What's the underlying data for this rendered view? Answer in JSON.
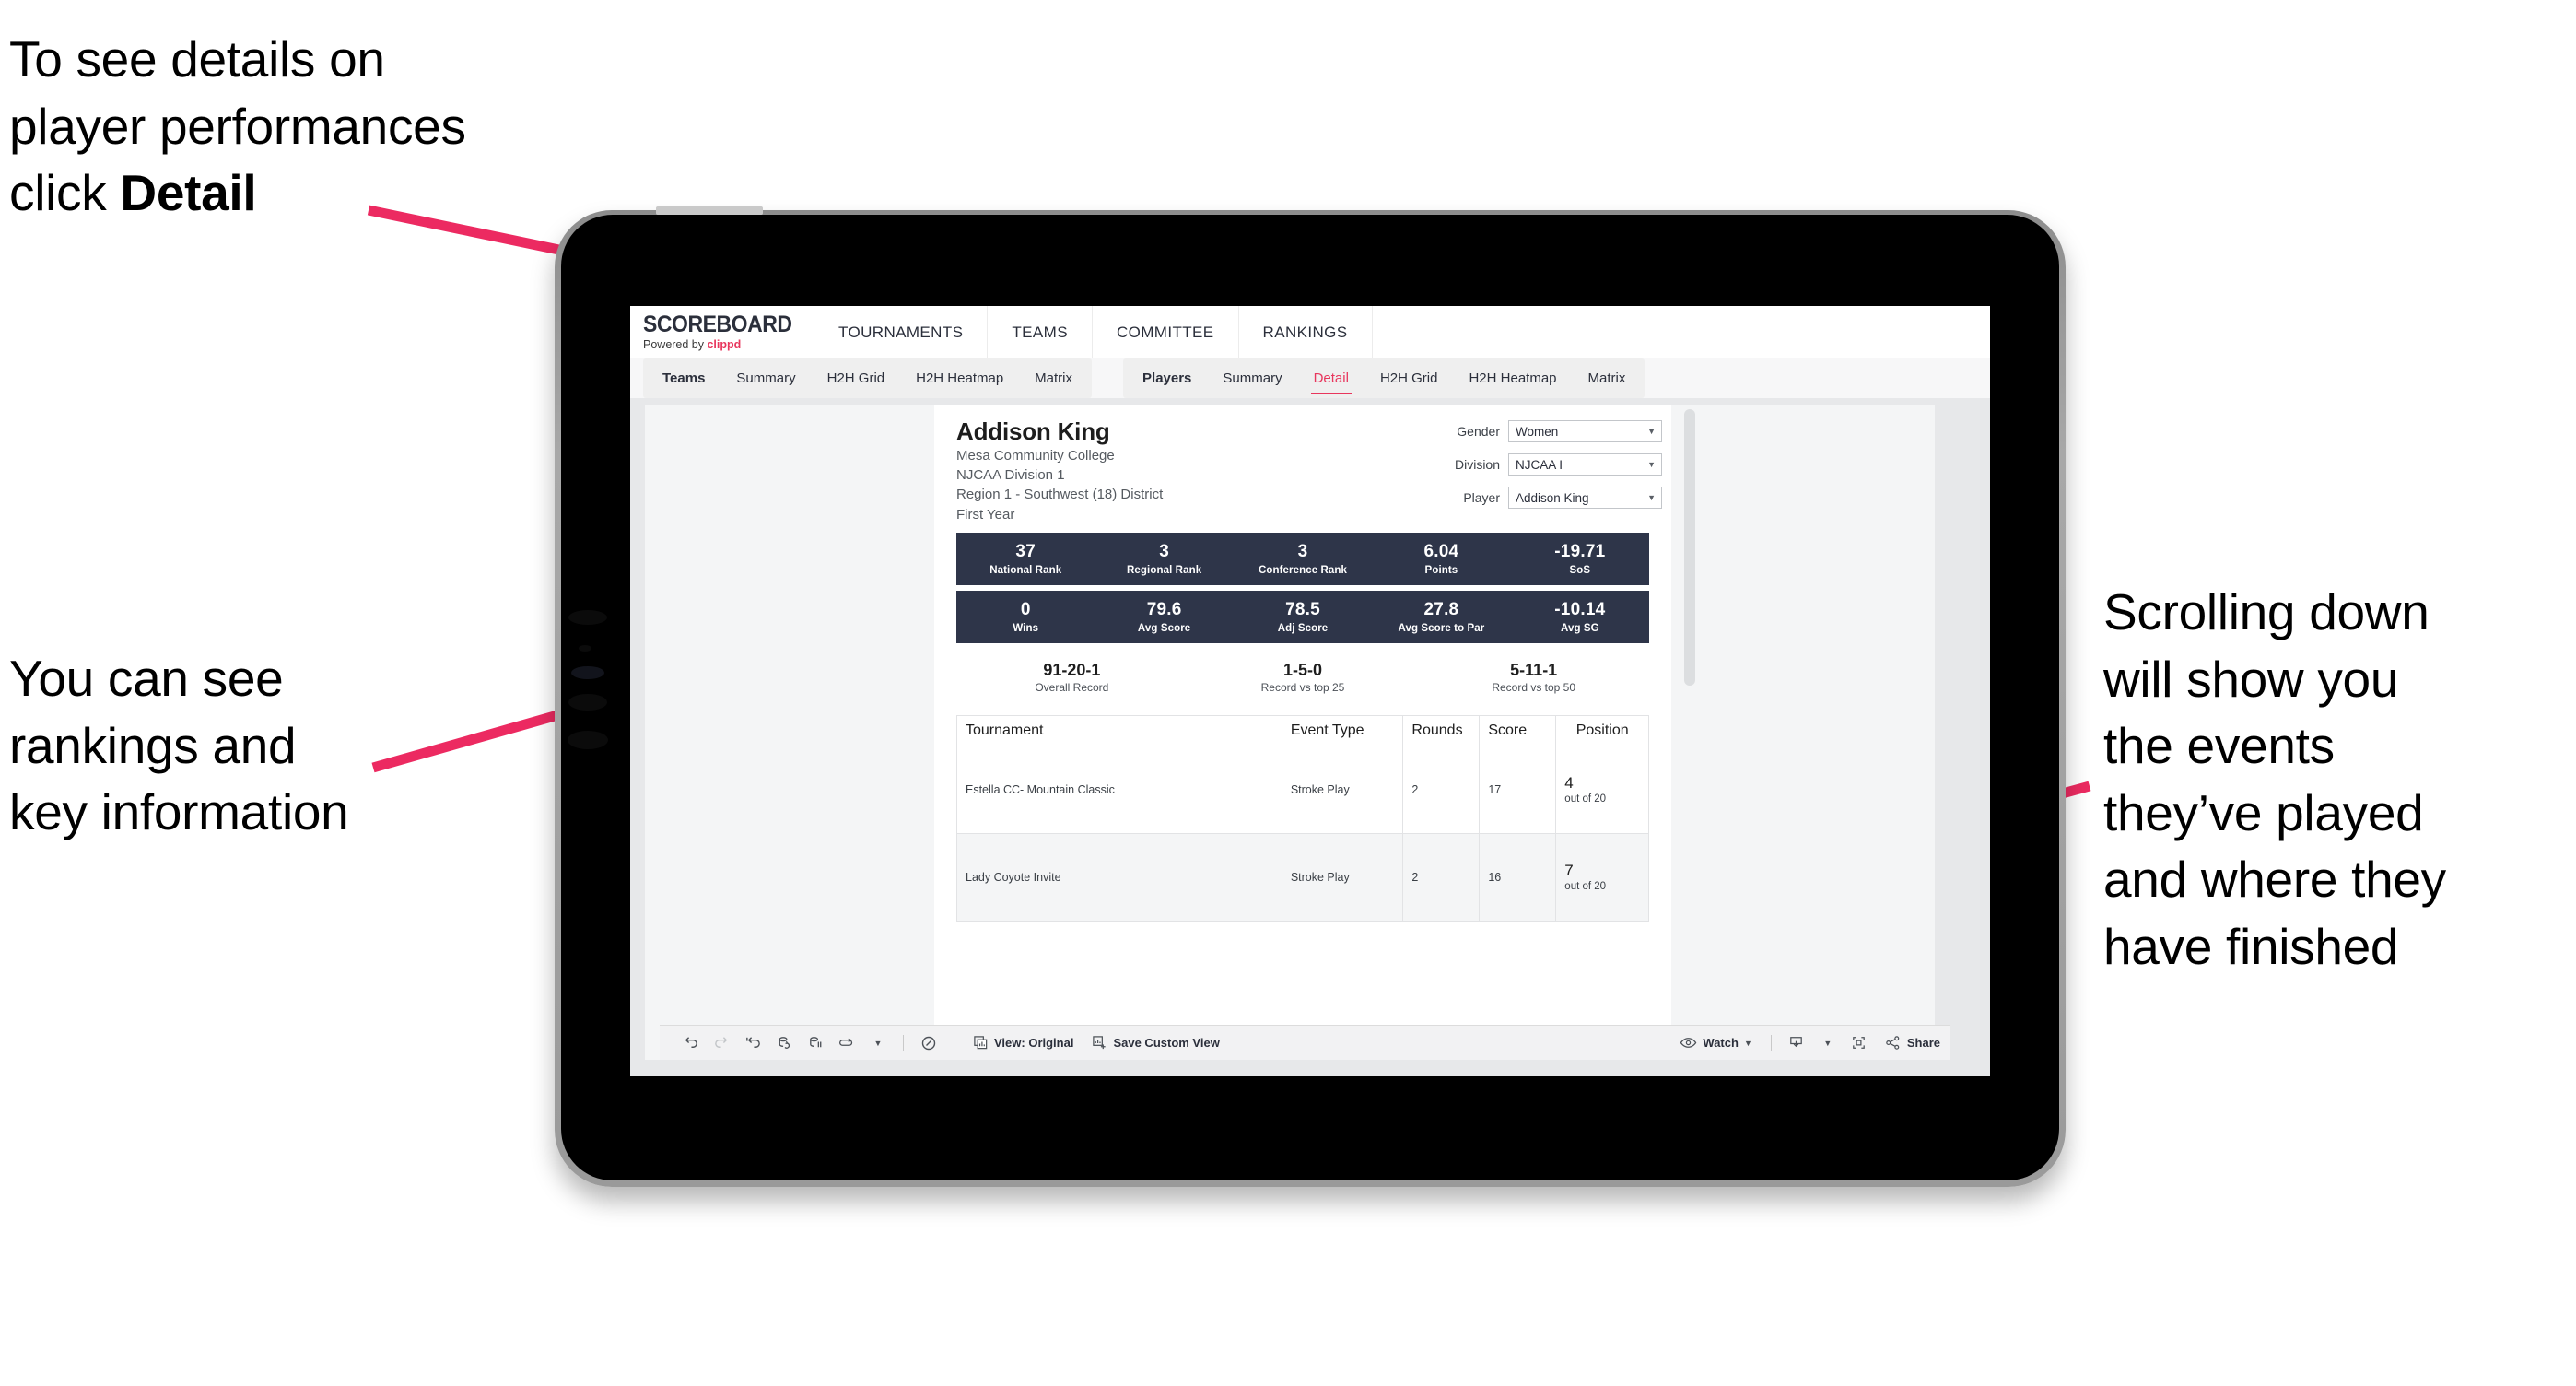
{
  "annotations": {
    "detail": {
      "text_plain": "To see details on\nplayer performances\nclick ",
      "bold_tail": "Detail"
    },
    "rankings": "You can see\nrankings and\nkey information",
    "scrolling": "Scrolling down\nwill show you\nthe events\nthey’ve played\nand where they\nhave finished",
    "arrow_color": "#ec2a61"
  },
  "app": {
    "logo": {
      "title": "SCOREBOARD",
      "powered_prefix": "Powered by ",
      "brand": "clippd"
    },
    "top_nav": [
      "TOURNAMENTS",
      "TEAMS",
      "COMMITTEE",
      "RANKINGS"
    ],
    "tab_group_teams": [
      {
        "label": "Teams",
        "bold": true,
        "active": false
      },
      {
        "label": "Summary",
        "bold": false,
        "active": false
      },
      {
        "label": "H2H Grid",
        "bold": false,
        "active": false
      },
      {
        "label": "H2H Heatmap",
        "bold": false,
        "active": false
      },
      {
        "label": "Matrix",
        "bold": false,
        "active": false
      }
    ],
    "tab_group_players": [
      {
        "label": "Players",
        "bold": true,
        "active": false
      },
      {
        "label": "Summary",
        "bold": false,
        "active": false
      },
      {
        "label": "Detail",
        "bold": false,
        "active": true
      },
      {
        "label": "H2H Grid",
        "bold": false,
        "active": false
      },
      {
        "label": "H2H Heatmap",
        "bold": false,
        "active": false
      },
      {
        "label": "Matrix",
        "bold": false,
        "active": false
      }
    ],
    "accent_color": "#e8365d",
    "statbar_color": "#2e3549"
  },
  "player": {
    "name": "Addison King",
    "school": "Mesa Community College",
    "division": "NJCAA Division 1",
    "region": "Region 1 - Southwest (18) District",
    "year": "First Year"
  },
  "filters": [
    {
      "label": "Gender",
      "value": "Women"
    },
    {
      "label": "Division",
      "value": "NJCAA I"
    },
    {
      "label": "Player",
      "value": "Addison King"
    }
  ],
  "stats_row_1": [
    {
      "value": "37",
      "label": "National Rank"
    },
    {
      "value": "3",
      "label": "Regional Rank"
    },
    {
      "value": "3",
      "label": "Conference Rank"
    },
    {
      "value": "6.04",
      "label": "Points"
    },
    {
      "value": "-19.71",
      "label": "SoS"
    }
  ],
  "stats_row_2": [
    {
      "value": "0",
      "label": "Wins"
    },
    {
      "value": "79.6",
      "label": "Avg Score"
    },
    {
      "value": "78.5",
      "label": "Adj Score"
    },
    {
      "value": "27.8",
      "label": "Avg Score to Par"
    },
    {
      "value": "-10.14",
      "label": "Avg SG"
    }
  ],
  "records": [
    {
      "value": "91-20-1",
      "label": "Overall Record"
    },
    {
      "value": "1-5-0",
      "label": "Record vs top 25"
    },
    {
      "value": "5-11-1",
      "label": "Record vs top 50"
    }
  ],
  "events_table": {
    "headers": [
      "Tournament",
      "Event Type",
      "Rounds",
      "Score",
      "Position"
    ],
    "rows": [
      {
        "tournament": "Estella CC- Mountain Classic",
        "event_type": "Stroke Play",
        "rounds": "2",
        "score": "17",
        "position": "4",
        "position_sub": "out of 20"
      },
      {
        "tournament": "Lady Coyote Invite",
        "event_type": "Stroke Play",
        "rounds": "2",
        "score": "16",
        "position": "7",
        "position_sub": "out of 20"
      }
    ]
  },
  "toolbar": {
    "view_label": "View: Original",
    "save_label": "Save Custom View",
    "watch_label": "Watch",
    "share_label": "Share"
  }
}
